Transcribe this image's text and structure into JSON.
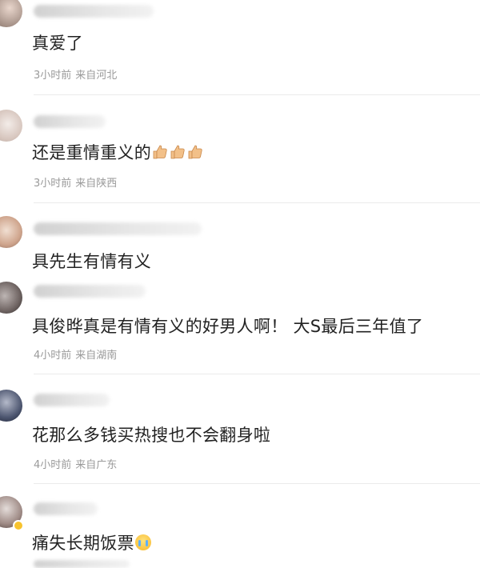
{
  "comments": [
    {
      "text": "真爱了",
      "time": "3小时前",
      "location": "来自河北"
    },
    {
      "text": "还是重情重义的",
      "emoji": "thumbs-up-emoji",
      "emoji_count": 3,
      "time": "3小时前",
      "location": "来自陕西"
    },
    {
      "text": "具先生有情有义"
    },
    {
      "text": "具俊晔真是有情有义的好男人啊！ 大S最后三年值了",
      "time": "4小时前",
      "location": "来自湖南"
    },
    {
      "text": "花那么多钱买热搜也不会翻身啦",
      "time": "4小时前",
      "location": "来自广东"
    },
    {
      "text": "痛失长期饭票",
      "emoji": "crying-emoji"
    }
  ],
  "colors": {
    "text": "#222222",
    "meta": "#9a9a9a",
    "divider": "#ebebeb",
    "verified_badge": "#f7c32e"
  }
}
